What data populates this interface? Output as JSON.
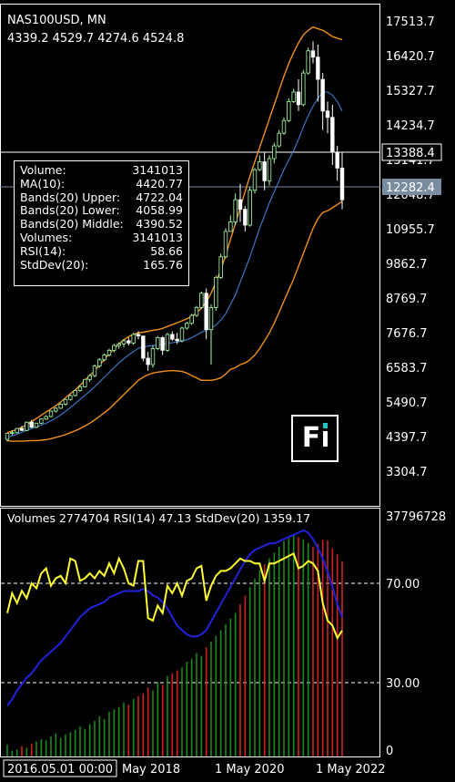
{
  "main": {
    "symbol_timeframe": "NAS100USD, MN",
    "ohlc": "4339.2 4529.7 4274.6 4524.8",
    "price_ticks": [
      "17513.7",
      "16420.7",
      "15327.7",
      "14234.7",
      "13141.7",
      "12048.7",
      "10955.7",
      "9862.7",
      "8769.7",
      "7676.7",
      "6583.7",
      "5490.7",
      "4397.7",
      "3304.7"
    ],
    "crosshair_label": "13388.4",
    "current_price_label": "12282.4"
  },
  "info": {
    "rows": [
      {
        "label": "Volume:",
        "value": "3141013"
      },
      {
        "label": "MA(10):",
        "value": "4420.77"
      },
      {
        "label": "Bands(20) Upper:",
        "value": "4722.04"
      },
      {
        "label": "Bands(20) Lower:",
        "value": "4058.99"
      },
      {
        "label": "Bands(20) Middle:",
        "value": "4390.52"
      },
      {
        "label": "Volumes:",
        "value": "3141013"
      },
      {
        "label": "RSI(14):",
        "value": "58.66"
      },
      {
        "label": "StdDev(20):",
        "value": "165.76"
      }
    ]
  },
  "sub": {
    "header": "Volumes 2774704 RSI(14) 47.13 StdDev(20) 1359.17",
    "ticks": [
      "37796728",
      "70.00",
      "30.00",
      "0"
    ]
  },
  "xaxis": {
    "highlight_label": "2016.05.01 00:00",
    "labels": [
      "May 2018",
      "1 May 2020",
      "1 May 2022"
    ]
  },
  "colors": {
    "bull": "#aaffaa",
    "bear": "#ffffff",
    "bands": "#f0901c",
    "ma": "#3a7fd5",
    "rsi": "#ffff33",
    "stddev": "#2222dd",
    "vol_up": "#1f8a1f",
    "vol_down": "#cc2222",
    "price_label_bg": "#7a8da0"
  },
  "chart_data": {
    "type": "candlestick",
    "ohlc": [
      [
        4339.2,
        4529.7,
        4274.6,
        4524.8
      ],
      [
        4524.8,
        4630,
        4470,
        4550
      ],
      [
        4550,
        4700,
        4520,
        4680
      ],
      [
        4680,
        4750,
        4600,
        4620
      ],
      [
        4620,
        4900,
        4600,
        4880
      ],
      [
        4880,
        4950,
        4700,
        4720
      ],
      [
        4720,
        4860,
        4690,
        4850
      ],
      [
        4850,
        5000,
        4820,
        4980
      ],
      [
        4980,
        5100,
        4950,
        5060
      ],
      [
        5060,
        5250,
        5030,
        5230
      ],
      [
        5230,
        5350,
        5180,
        5320
      ],
      [
        5320,
        5480,
        5300,
        5450
      ],
      [
        5450,
        5620,
        5400,
        5600
      ],
      [
        5600,
        5750,
        5560,
        5720
      ],
      [
        5720,
        5900,
        5690,
        5880
      ],
      [
        5880,
        6050,
        5850,
        6000
      ],
      [
        6000,
        6250,
        5980,
        6230
      ],
      [
        6230,
        6400,
        6150,
        6350
      ],
      [
        6350,
        6700,
        6300,
        6650
      ],
      [
        6650,
        6900,
        6600,
        6850
      ],
      [
        6850,
        7050,
        6800,
        7000
      ],
      [
        7000,
        7200,
        6950,
        7150
      ],
      [
        7150,
        7350,
        7080,
        7300
      ],
      [
        7300,
        7400,
        7200,
        7350
      ],
      [
        7350,
        7500,
        7250,
        7450
      ],
      [
        7450,
        7550,
        7300,
        7380
      ],
      [
        7380,
        7700,
        7320,
        7650
      ],
      [
        7650,
        7750,
        7500,
        7600
      ],
      [
        7600,
        7300,
        6800,
        6900
      ],
      [
        6900,
        7100,
        6500,
        6700
      ],
      [
        6700,
        7300,
        6600,
        7200
      ],
      [
        7200,
        7600,
        7150,
        7550
      ],
      [
        7550,
        7600,
        7000,
        7150
      ],
      [
        7150,
        7700,
        7100,
        7650
      ],
      [
        7650,
        7750,
        7450,
        7500
      ],
      [
        7500,
        7700,
        7350,
        7450
      ],
      [
        7450,
        7900,
        7400,
        7850
      ],
      [
        7850,
        8050,
        7800,
        8000
      ],
      [
        8000,
        8300,
        7950,
        8250
      ],
      [
        8250,
        8550,
        8200,
        8500
      ],
      [
        8500,
        9000,
        8450,
        8950
      ],
      [
        8950,
        9100,
        7500,
        7800
      ],
      [
        7800,
        8600,
        6700,
        8500
      ],
      [
        8500,
        9500,
        8400,
        9450
      ],
      [
        9450,
        10200,
        9400,
        10100
      ],
      [
        10100,
        11000,
        10050,
        10900
      ],
      [
        10900,
        11400,
        11000,
        11200
      ],
      [
        11200,
        12100,
        11100,
        11900
      ],
      [
        11900,
        12400,
        11200,
        11600
      ],
      [
        11600,
        11700,
        10900,
        11100
      ],
      [
        11100,
        12300,
        11050,
        12200
      ],
      [
        12200,
        12900,
        12100,
        12850
      ],
      [
        12850,
        13300,
        12800,
        13100
      ],
      [
        13100,
        13400,
        12200,
        12500
      ],
      [
        12500,
        13300,
        12350,
        13200
      ],
      [
        13200,
        13700,
        13050,
        13600
      ],
      [
        13600,
        14100,
        13550,
        14000
      ],
      [
        14000,
        14500,
        13950,
        14400
      ],
      [
        14400,
        15100,
        14350,
        15000
      ],
      [
        15000,
        15400,
        14950,
        15300
      ],
      [
        15300,
        15700,
        14700,
        14900
      ],
      [
        14900,
        16000,
        14850,
        15900
      ],
      [
        15900,
        16700,
        15850,
        16600
      ],
      [
        16600,
        16900,
        16200,
        16400
      ],
      [
        16400,
        16800,
        15000,
        15700
      ],
      [
        15700,
        15900,
        14100,
        14700
      ],
      [
        14700,
        15000,
        14000,
        14500
      ],
      [
        14500,
        14900,
        13000,
        13400
      ],
      [
        13400,
        13600,
        12500,
        12900
      ],
      [
        12900,
        13400,
        11600,
        11900
      ]
    ],
    "ma10": [
      4400,
      4450,
      4500,
      4560,
      4620,
      4680,
      4730,
      4790,
      4850,
      4920,
      5010,
      5110,
      5220,
      5340,
      5470,
      5600,
      5730,
      5860,
      6000,
      6150,
      6300,
      6450,
      6600,
      6750,
      6880,
      7000,
      7110,
      7210,
      7260,
      7280,
      7300,
      7320,
      7340,
      7370,
      7390,
      7410,
      7440,
      7480,
      7550,
      7630,
      7720,
      7780,
      7850,
      7950,
      8100,
      8300,
      8600,
      8900,
      9300,
      9700,
      10100,
      10550,
      11000,
      11400,
      11800,
      12150,
      12500,
      12850,
      13150,
      13450,
      13800,
      14200,
      14550,
      14850,
      15100,
      15300,
      15300,
      15200,
      15000,
      14700
    ],
    "band_upper": [
      4550,
      4600,
      4650,
      4720,
      4800,
      4900,
      5000,
      5100,
      5200,
      5300,
      5400,
      5520,
      5650,
      5780,
      5900,
      6050,
      6200,
      6350,
      6500,
      6680,
      6860,
      7040,
      7200,
      7350,
      7480,
      7580,
      7650,
      7700,
      7720,
      7750,
      7780,
      7800,
      7840,
      7900,
      7960,
      8020,
      8080,
      8140,
      8220,
      8330,
      8480,
      8680,
      8950,
      9300,
      9700,
      10150,
      10650,
      11150,
      11650,
      12150,
      12650,
      13100,
      13550,
      14000,
      14450,
      14900,
      15350,
      15800,
      16200,
      16550,
      16850,
      17100,
      17250,
      17350,
      17300,
      17250,
      17150,
      17050,
      17000,
      16950
    ],
    "band_lower": [
      4300,
      4280,
      4280,
      4280,
      4290,
      4300,
      4300,
      4310,
      4330,
      4360,
      4400,
      4440,
      4490,
      4550,
      4610,
      4680,
      4760,
      4850,
      4950,
      5060,
      5180,
      5300,
      5450,
      5600,
      5750,
      5900,
      6050,
      6200,
      6300,
      6380,
      6430,
      6460,
      6480,
      6500,
      6510,
      6500,
      6480,
      6430,
      6350,
      6280,
      6200,
      6200,
      6200,
      6230,
      6280,
      6400,
      6550,
      6600,
      6700,
      6750,
      6850,
      7000,
      7200,
      7450,
      7700,
      8000,
      8350,
      8700,
      9050,
      9400,
      9800,
      10200,
      10600,
      11000,
      11300,
      11500,
      11550,
      11650,
      11750,
      11850
    ],
    "volume": [
      200,
      100,
      120,
      180,
      150,
      220,
      260,
      300,
      280,
      350,
      400,
      320,
      380,
      420,
      460,
      520,
      480,
      560,
      620,
      700,
      650,
      780,
      820,
      860,
      940,
      900,
      1000,
      1050,
      1100,
      1200,
      1150,
      1300,
      1250,
      1400,
      1450,
      1500,
      1550,
      1650,
      1700,
      1800,
      1750,
      1900,
      2000,
      2100,
      2200,
      2300,
      2400,
      2500,
      2650,
      2800,
      2950,
      3100,
      3250,
      3350,
      3450,
      3550,
      3650,
      3750,
      3800,
      3850,
      3820,
      3780,
      3720,
      3650,
      3700,
      3780,
      3760,
      3620,
      3520,
      3400
    ],
    "volume_up": [
      true,
      true,
      true,
      false,
      true,
      false,
      true,
      true,
      true,
      true,
      true,
      true,
      true,
      true,
      true,
      true,
      true,
      true,
      true,
      true,
      true,
      true,
      true,
      true,
      true,
      false,
      true,
      false,
      false,
      false,
      true,
      true,
      false,
      true,
      false,
      false,
      true,
      true,
      true,
      true,
      true,
      false,
      true,
      true,
      true,
      true,
      true,
      true,
      false,
      false,
      true,
      true,
      true,
      false,
      true,
      true,
      true,
      true,
      true,
      true,
      false,
      true,
      true,
      false,
      false,
      false,
      false,
      false,
      false,
      false
    ],
    "rsi": [
      58,
      66,
      62,
      67,
      64,
      70,
      68,
      74,
      76,
      69,
      72,
      73,
      70,
      80,
      79,
      71,
      72,
      74,
      72,
      75,
      73,
      78,
      74,
      80,
      76,
      70,
      69,
      79,
      79,
      56,
      55,
      61,
      58,
      69,
      66,
      70,
      65,
      71,
      72,
      76,
      77,
      63,
      69,
      73,
      75,
      75,
      76,
      78,
      80,
      79,
      79,
      78,
      78,
      71,
      78,
      78,
      79,
      80,
      81,
      82,
      76,
      77,
      79,
      78,
      75,
      62,
      55,
      53,
      48,
      51
    ],
    "stddev": [
      15,
      18,
      22,
      25,
      28,
      30,
      33,
      36,
      38,
      40,
      42,
      44,
      47,
      50,
      53,
      56,
      58,
      60,
      61,
      62,
      63,
      65,
      66,
      67,
      68,
      68,
      68,
      68,
      69,
      68,
      66,
      65,
      63,
      60,
      56,
      52,
      50,
      48,
      47,
      47,
      48,
      50,
      54,
      58,
      62,
      66,
      70,
      74,
      78,
      82,
      85,
      87,
      88,
      89,
      90,
      90,
      91,
      92,
      93,
      94,
      95,
      96,
      95,
      92,
      88,
      83,
      77,
      70,
      62,
      56
    ]
  }
}
